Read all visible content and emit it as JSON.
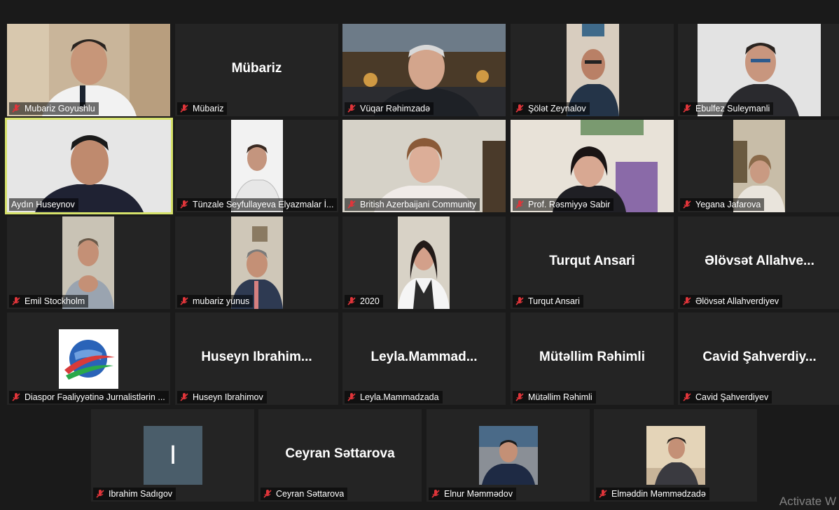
{
  "participants": [
    {
      "name": "Mubariz Goyushlu",
      "display": ""
    },
    {
      "name": "Mübariz",
      "display": "Mübariz"
    },
    {
      "name": "Vüqar Rəhimzadə",
      "display": ""
    },
    {
      "name": "Şölət Zeynalov",
      "display": ""
    },
    {
      "name": "Ebulfez Suleymanli",
      "display": ""
    },
    {
      "name": "Aydın Huseynov",
      "display": ""
    },
    {
      "name": "Tünzale Seyfullayeva Elyazmalar İ...",
      "display": ""
    },
    {
      "name": "British Azerbaijani Community",
      "display": ""
    },
    {
      "name": "Prof. Rəsmiyyə Sabir",
      "display": ""
    },
    {
      "name": "Yegana Jafarova",
      "display": ""
    },
    {
      "name": "Emil  Stockholm",
      "display": ""
    },
    {
      "name": "mubariz yunus",
      "display": ""
    },
    {
      "name": "2020",
      "display": ""
    },
    {
      "name": "Turqut Ansari",
      "display": "Turqut Ansari"
    },
    {
      "name": "Əlövsət Allahverdiyev",
      "display": "Əlövsət  Allahve..."
    },
    {
      "name": "Diaspor Fəaliyyətinə Jurnalistlərin ...",
      "display": ""
    },
    {
      "name": "Huseyn Ibrahimov",
      "display": "Huseyn  Ibrahim..."
    },
    {
      "name": "Leyla.Mammadzada",
      "display": "Leyla.Mammad..."
    },
    {
      "name": "Mütəllim Rəhimli",
      "display": "Mütəllim Rəhimli"
    },
    {
      "name": "Cavid Şahverdiyev",
      "display": "Cavid  Şahverdiy..."
    },
    {
      "name": "Ibrahim Sadıgov",
      "display": ""
    },
    {
      "name": "Ceyran Səttarova",
      "display": "Ceyran Səttarova"
    },
    {
      "name": "Elnur Məmmədov",
      "display": ""
    },
    {
      "name": "Elməddin Məmmədzadə",
      "display": ""
    }
  ],
  "avatar_letter": "I",
  "watermark": "Activate W",
  "colors": {
    "active_border": "#d6e26a",
    "muted_icon": "#e0353a",
    "background": "#1a1a1a",
    "tile": "#242424"
  }
}
